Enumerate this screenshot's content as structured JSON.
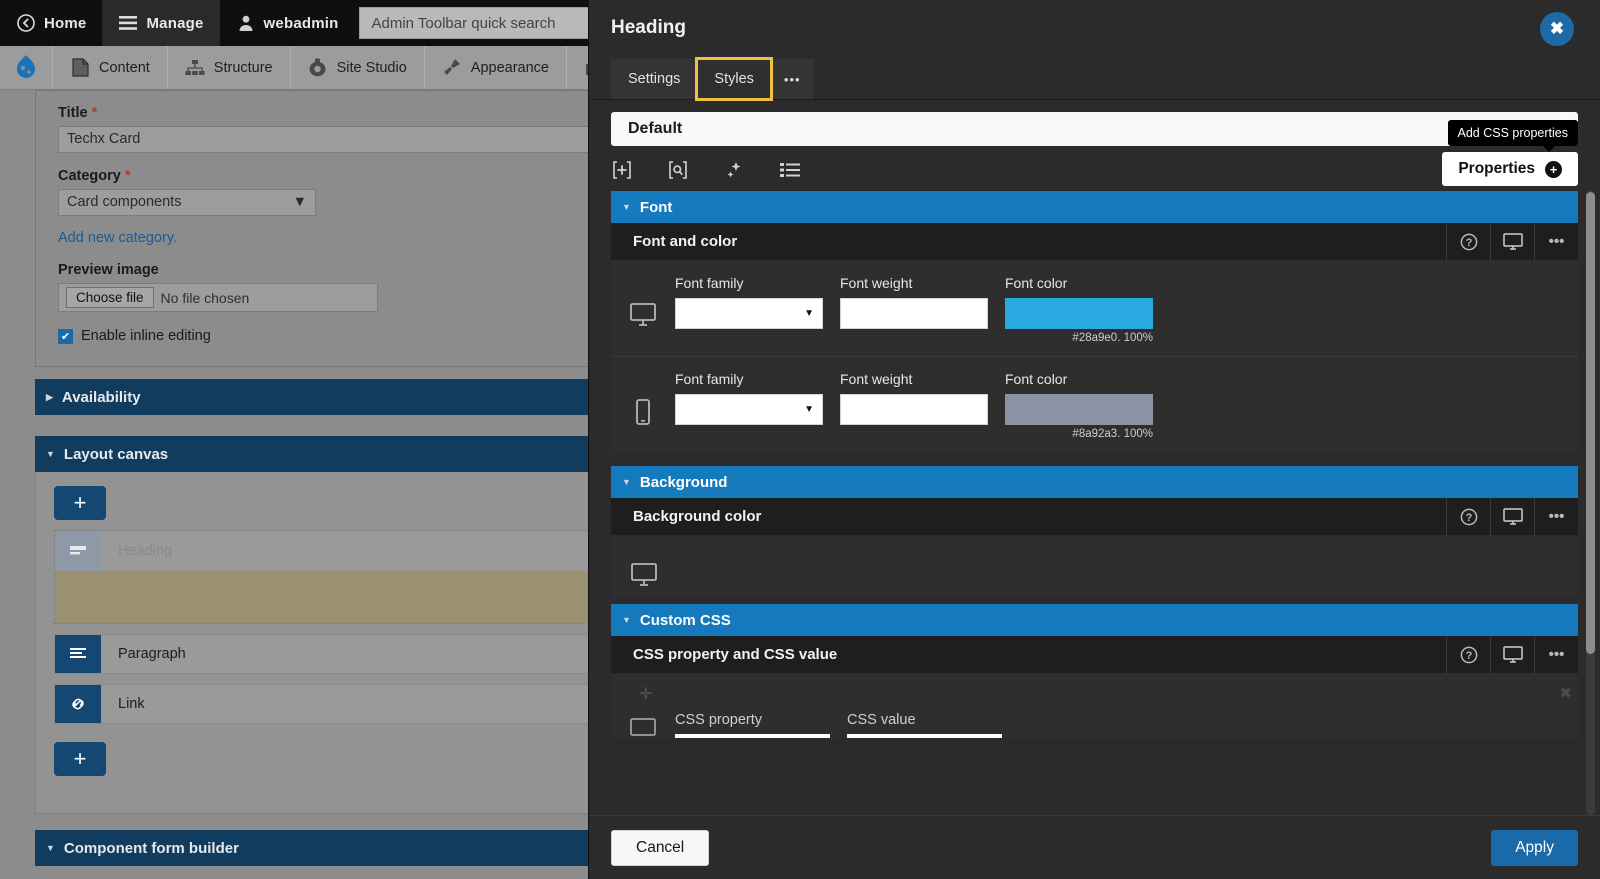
{
  "admin_toolbar": {
    "home": "Home",
    "manage": "Manage",
    "user": "webadmin",
    "search_placeholder": "Admin Toolbar quick search"
  },
  "admin_menu": {
    "items": [
      {
        "label": "Content",
        "icon": "document-icon"
      },
      {
        "label": "Structure",
        "icon": "sitemap-icon"
      },
      {
        "label": "Site Studio",
        "icon": "site-studio-icon"
      },
      {
        "label": "Appearance",
        "icon": "paint-brush-icon"
      }
    ]
  },
  "node_form": {
    "title_label": "Title",
    "title_value": "Techx Card",
    "category_label": "Category",
    "category_value": "Card components",
    "add_category_link": "Add new category.",
    "preview_image_label": "Preview image",
    "choose_file_button": "Choose file",
    "no_file_text": "No file chosen",
    "inline_editing_label": "Enable inline editing",
    "required_marker": "*"
  },
  "accordions": {
    "availability": "Availability",
    "layout_canvas": "Layout canvas",
    "component_form_builder": "Component form builder"
  },
  "layout_canvas": {
    "add_button_top": "+",
    "add_button_bottom": "+",
    "components": [
      {
        "name": "Heading",
        "icon": "heading-icon",
        "selected": true
      },
      {
        "name": "Paragraph",
        "icon": "paragraph-icon",
        "selected": false
      },
      {
        "name": "Link",
        "icon": "link-icon",
        "selected": false
      }
    ]
  },
  "modal": {
    "title": "Heading",
    "close_label": "✖",
    "tabs": [
      {
        "label": "Settings",
        "selected": false
      },
      {
        "label": "Styles",
        "selected": true
      },
      {
        "label": "•••",
        "selected": false
      }
    ],
    "style_selector_value": "Default",
    "tooltip": "Add CSS properties",
    "properties_button": "Properties",
    "properties_plus": "+",
    "toolbar_icons": [
      {
        "name": "add-style-icon",
        "glyph": "[+]"
      },
      {
        "name": "find-style-icon",
        "glyph": "[Q]"
      },
      {
        "name": "magic-style-icon",
        "glyph": "✦"
      },
      {
        "name": "list-style-icon",
        "glyph": "☰"
      }
    ],
    "sections": [
      {
        "name": "Font",
        "sub_title": "Font and color",
        "rows": [
          {
            "device": "desktop",
            "fields": [
              {
                "label": "Font family",
                "type": "select",
                "value": ""
              },
              {
                "label": "Font weight",
                "type": "text",
                "value": ""
              },
              {
                "label": "Font color",
                "type": "color",
                "value": "#28a9e0",
                "caption": "#28a9e0. 100%"
              }
            ]
          },
          {
            "device": "mobile",
            "fields": [
              {
                "label": "Font family",
                "type": "select",
                "value": ""
              },
              {
                "label": "Font weight",
                "type": "text",
                "value": ""
              },
              {
                "label": "Font color",
                "type": "color",
                "value": "#8a92a3",
                "caption": "#8a92a3. 100%"
              }
            ]
          }
        ]
      },
      {
        "name": "Background",
        "sub_title": "Background color",
        "rows": [
          {
            "device": "desktop",
            "fields": []
          }
        ]
      },
      {
        "name": "Custom CSS",
        "sub_title": "CSS property and CSS value",
        "rows": [
          {
            "device": "desktop",
            "fields": [
              {
                "label": "CSS property",
                "type": "underline",
                "value": ""
              },
              {
                "label": "CSS value",
                "type": "underline",
                "value": ""
              }
            ]
          }
        ]
      }
    ],
    "footer": {
      "cancel": "Cancel",
      "apply": "Apply"
    }
  },
  "colors": {
    "accent_blue": "#1479bd",
    "apply_blue": "#1a69a8",
    "highlight_yellow": "#f0c040",
    "font_color_desktop": "#28a9e0",
    "font_color_mobile": "#8a92a3"
  }
}
